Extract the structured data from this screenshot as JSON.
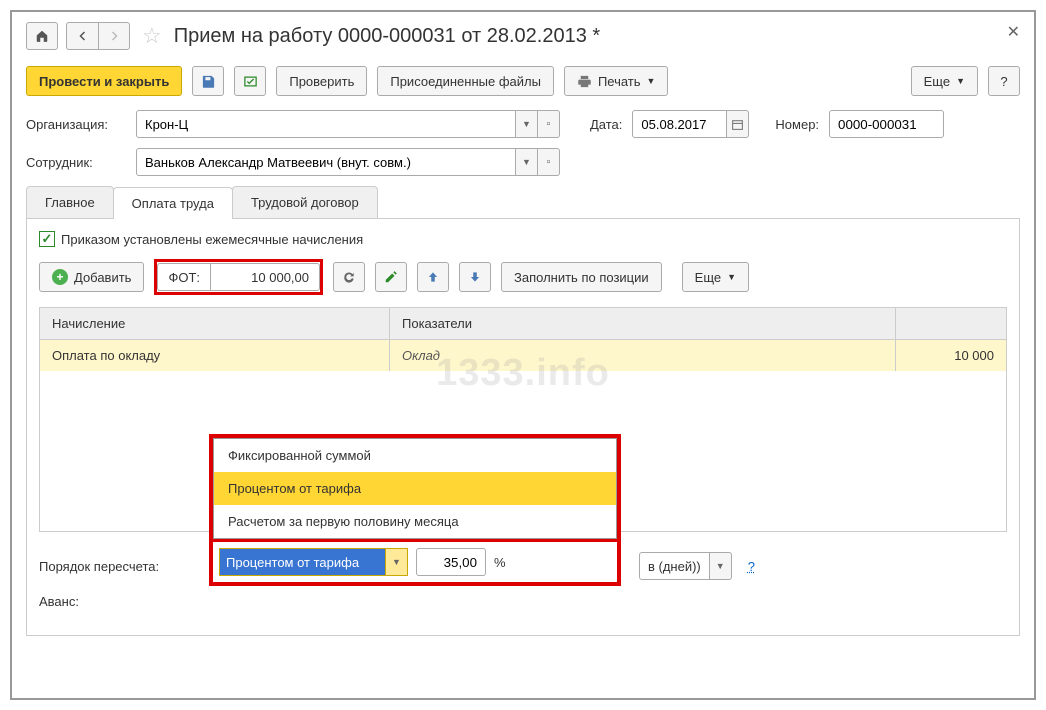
{
  "title": "Прием на работу 0000-000031 от 28.02.2013 *",
  "toolbar": {
    "conduct_close": "Провести и закрыть",
    "check": "Проверить",
    "attached": "Присоединенные файлы",
    "print": "Печать",
    "more": "Еще"
  },
  "fields": {
    "org_label": "Организация:",
    "org_value": "Крон-Ц",
    "date_label": "Дата:",
    "date_value": "05.08.2017",
    "num_label": "Номер:",
    "num_value": "0000-000031",
    "employee_label": "Сотрудник:",
    "employee_value": "Ваньков Александр Матвеевич (внут. совм.)"
  },
  "tabs": {
    "main": "Главное",
    "pay": "Оплата труда",
    "contract": "Трудовой договор"
  },
  "checkbox_label": "Приказом установлены ежемесячные начисления",
  "subtoolbar": {
    "add": "Добавить",
    "fot_label": "ФОТ:",
    "fot_value": "10 000,00",
    "fill_by_pos": "Заполнить по позиции",
    "more": "Еще"
  },
  "table": {
    "h1": "Начисление",
    "h2": "Показатели",
    "r1c1": "Оплата по окладу",
    "r1c2": "Оклад",
    "r1c3": "10 000"
  },
  "dropdown": {
    "opt1": "Фиксированной суммой",
    "opt2": "Процентом от тарифа",
    "opt3": "Расчетом за первую половину месяца"
  },
  "bottom": {
    "recalc_label": "Порядок пересчета:",
    "recalc_stub": "в (дней))",
    "avans_label": "Аванс:",
    "avans_value": "Процентом от тарифа",
    "avans_pct": "35,00",
    "pct_sign": "%"
  },
  "watermark": "1333.info"
}
